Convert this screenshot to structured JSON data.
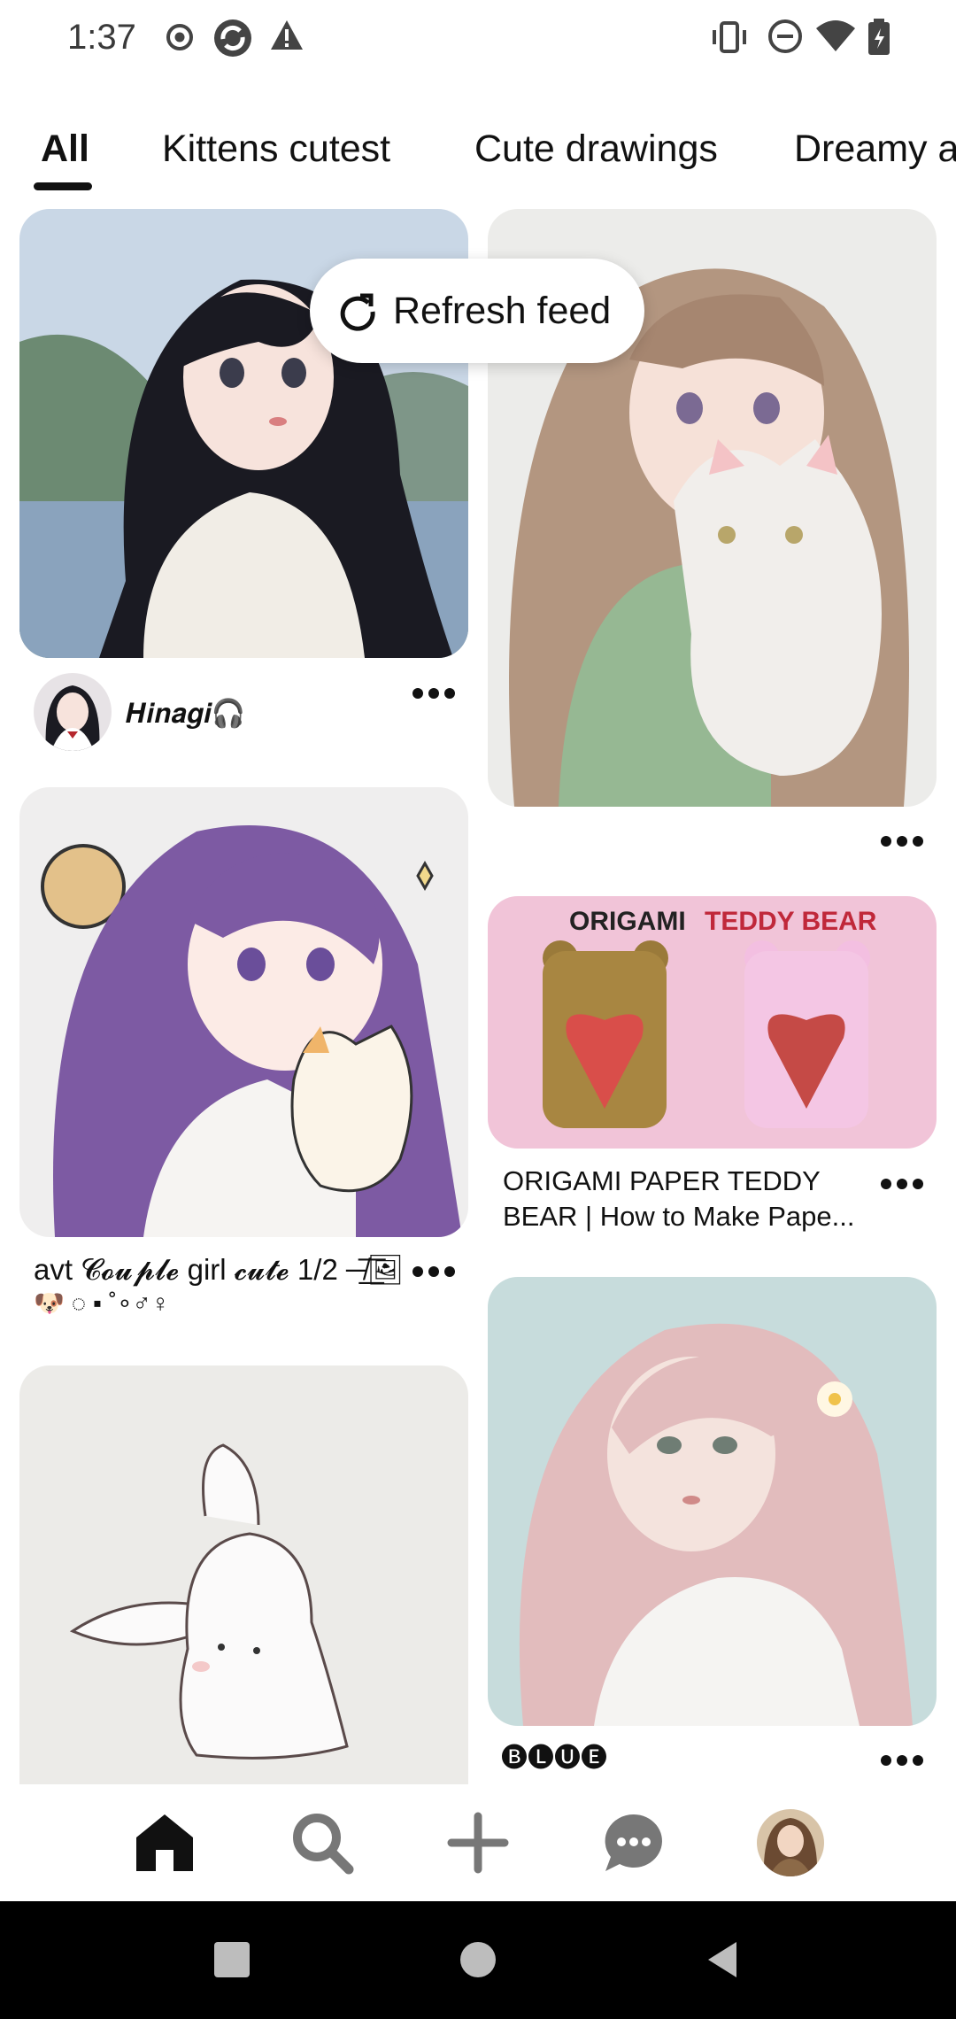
{
  "status_bar": {
    "time": "1:37",
    "left_icons": [
      "record-icon",
      "sync-icon",
      "warning-icon"
    ],
    "right_icons": [
      "vibrate-icon",
      "do-not-disturb-icon",
      "wifi-icon",
      "battery-icon"
    ]
  },
  "tabs": [
    {
      "label": "All",
      "selected": true
    },
    {
      "label": "Kittens cutest",
      "selected": false
    },
    {
      "label": "Cute drawings",
      "selected": false
    },
    {
      "label": "Dreamy a",
      "selected": false
    }
  ],
  "refresh_feed": {
    "label": "Refresh feed",
    "icon": "refresh-icon"
  },
  "feed": {
    "pins": [
      {
        "id": "pin-1",
        "author": "𝑯𝒊𝒏𝒂𝒈𝒊🎧",
        "image": "anime girl with long black hair"
      },
      {
        "id": "pin-2",
        "image": "girl holding white kitten"
      },
      {
        "id": "pin-3",
        "caption_line1": "avt 𝓒𝓸𝓾𝓹𝓵𝓮 girl 𝓬𝓾𝓽𝓮 1/2 ─̸͟͞🖼",
        "caption_line2": "🐶 ◌ ▪ ˚∘♂♀",
        "image": "purple hair girl with kitten"
      },
      {
        "id": "pin-4",
        "image_title_left": "ORIGAMI",
        "image_title_right": "TEDDY BEAR",
        "caption": "ORIGAMI PAPER TEDDY BEAR | How to Make Pape..."
      },
      {
        "id": "pin-5",
        "image": "bunny sketch"
      },
      {
        "id": "pin-6",
        "caption": "🅑🅛🅤🅔",
        "image": "pink hair girl with flower"
      }
    ]
  },
  "bottom_nav": [
    {
      "name": "home",
      "icon": "home-icon",
      "active": true
    },
    {
      "name": "search",
      "icon": "search-icon"
    },
    {
      "name": "create",
      "icon": "plus-icon"
    },
    {
      "name": "messages",
      "icon": "chat-icon"
    },
    {
      "name": "profile",
      "icon": "avatar-icon"
    }
  ],
  "system_nav": [
    "recents-icon",
    "home-circle-icon",
    "back-icon"
  ]
}
